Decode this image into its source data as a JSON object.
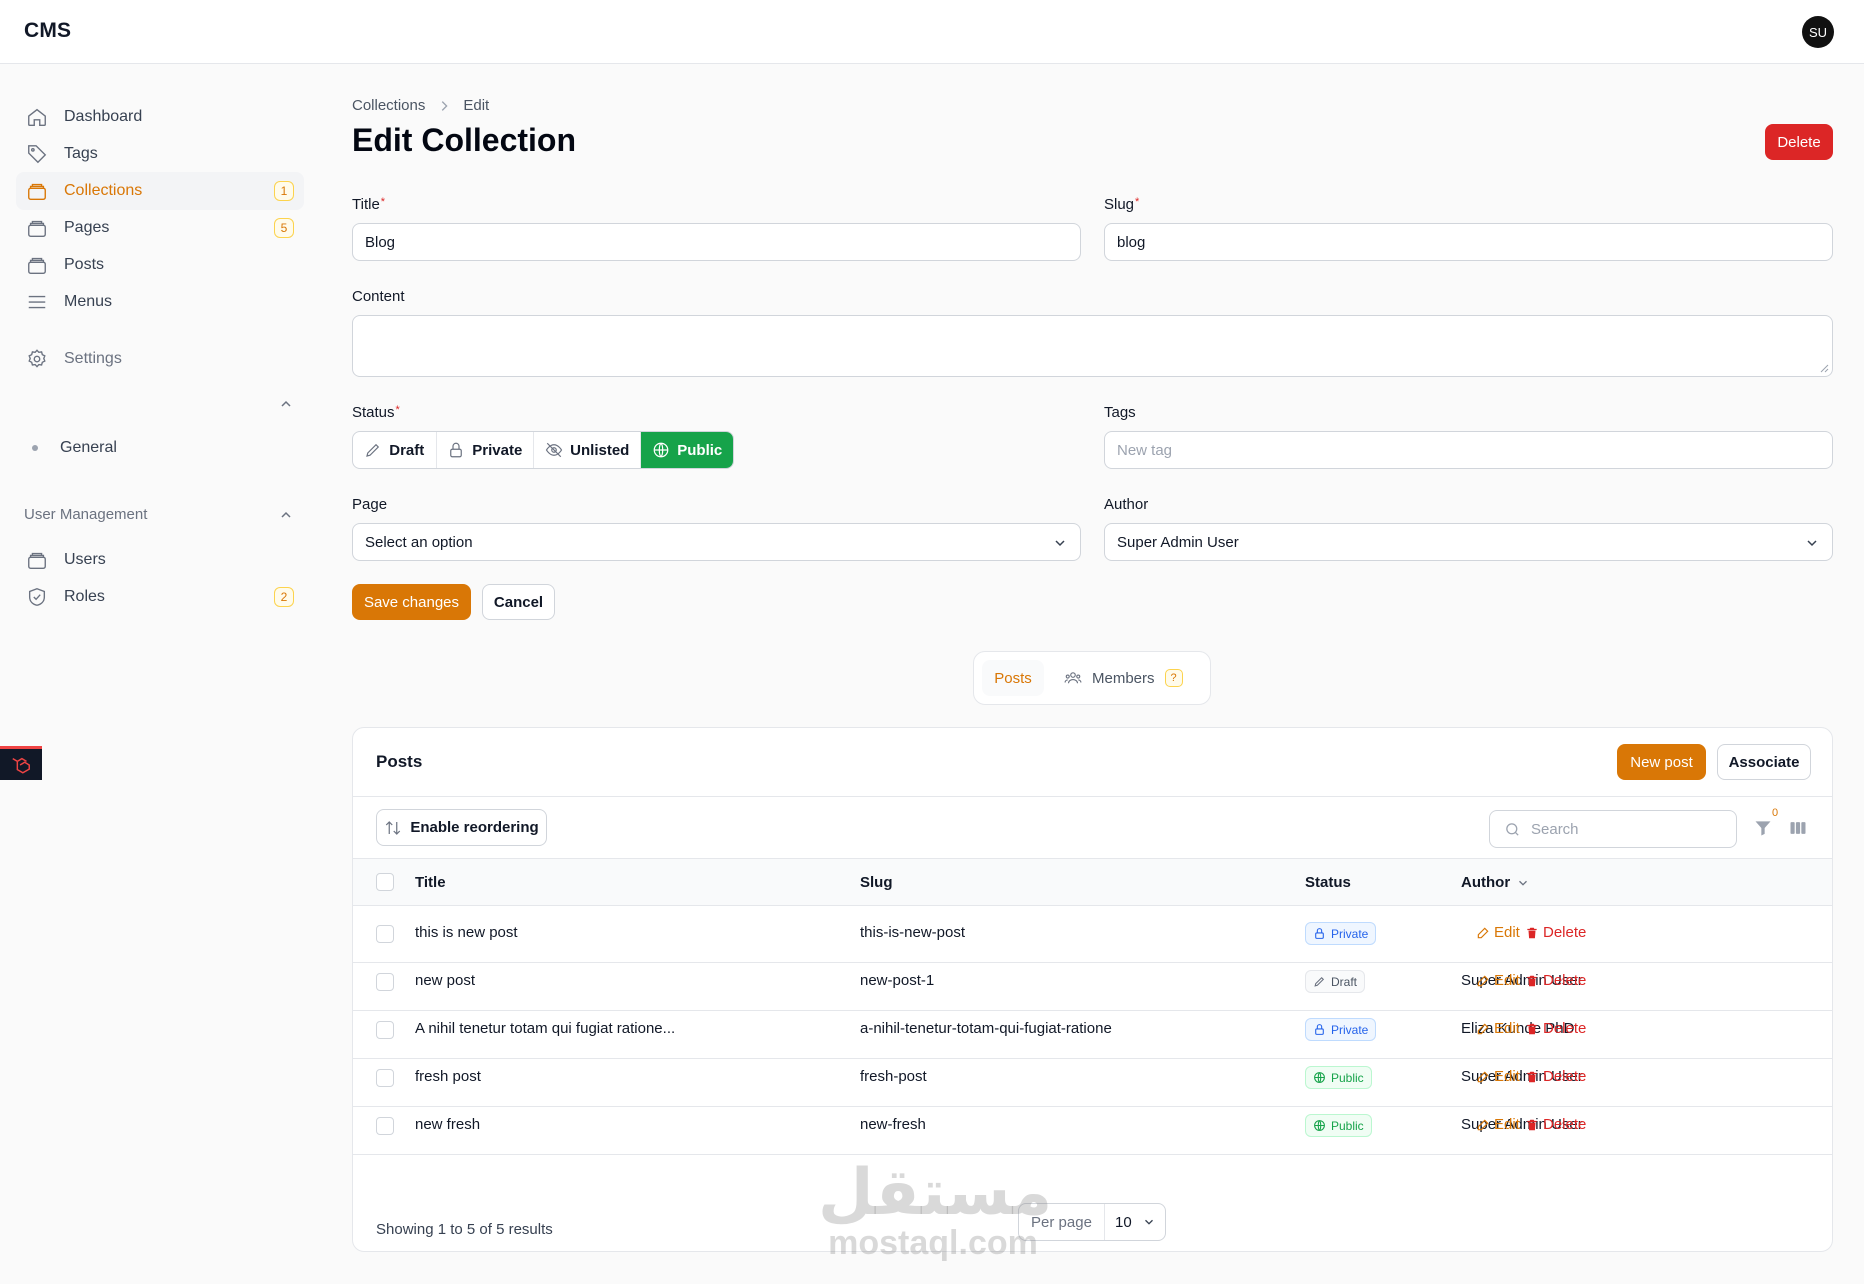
{
  "app": {
    "brand": "CMS",
    "avatar_initials": "SU"
  },
  "sidebar": {
    "items": [
      {
        "label": "Dashboard"
      },
      {
        "label": "Tags"
      },
      {
        "label": "Collections",
        "badge": "1"
      },
      {
        "label": "Pages",
        "badge": "5"
      },
      {
        "label": "Posts"
      },
      {
        "label": "Menus"
      }
    ],
    "settings": {
      "label": "Settings",
      "sub": [
        "General"
      ]
    },
    "user_management": {
      "label": "User Management"
    },
    "user_items": [
      {
        "label": "Users"
      },
      {
        "label": "Roles",
        "badge": "2"
      }
    ]
  },
  "breadcrumb": [
    "Collections",
    "Edit"
  ],
  "page_title": "Edit Collection",
  "header_actions": {
    "delete_label": "Delete"
  },
  "form": {
    "title_label": "Title",
    "title_value": "Blog",
    "slug_label": "Slug",
    "slug_value": "blog",
    "content_label": "Content",
    "status_label": "Status",
    "status_options": [
      "Draft",
      "Private",
      "Unlisted",
      "Public"
    ],
    "status_selected": "Public",
    "tags_label": "Tags",
    "tags_placeholder": "New tag",
    "page_label": "Page",
    "page_value": "Select an option",
    "author_label": "Author",
    "author_value": "Super Admin User",
    "save_label": "Save changes",
    "cancel_label": "Cancel"
  },
  "tabs": {
    "posts": "Posts",
    "members": "Members",
    "members_badge": "?"
  },
  "posts_table": {
    "title": "Posts",
    "new_post_label": "New post",
    "associate_label": "Associate",
    "reorder_label": "Enable reordering",
    "search_placeholder": "Search",
    "filter_count": "0",
    "columns": [
      "Title",
      "Slug",
      "Status",
      "Author"
    ],
    "rows": [
      {
        "title": "this is new post",
        "slug": "this-is-new-post",
        "status": "Private",
        "author": ""
      },
      {
        "title": "new post",
        "slug": "new-post-1",
        "status": "Draft",
        "author": "Super Admin User"
      },
      {
        "title": "A nihil tenetur totam qui fugiat ratione...",
        "slug": "a-nihil-tenetur-totam-qui-fugiat-ratione",
        "status": "Private",
        "author": "Eliza Kunde PhD"
      },
      {
        "title": "fresh post",
        "slug": "fresh-post",
        "status": "Public",
        "author": "Super Admin User"
      },
      {
        "title": "new fresh",
        "slug": "new-fresh",
        "status": "Public",
        "author": "Super Admin User"
      }
    ],
    "edit_label": "Edit",
    "delete_label": "Delete",
    "summary": "Showing 1 to 5 of 5 results",
    "per_page_label": "Per page",
    "per_page_value": "10"
  },
  "watermark": {
    "line1": "مستقل",
    "line2": "mostaql.com"
  },
  "colors": {
    "accent": "#d97706",
    "danger": "#dc2626",
    "success": "#16a34a",
    "info": "#2563eb"
  }
}
